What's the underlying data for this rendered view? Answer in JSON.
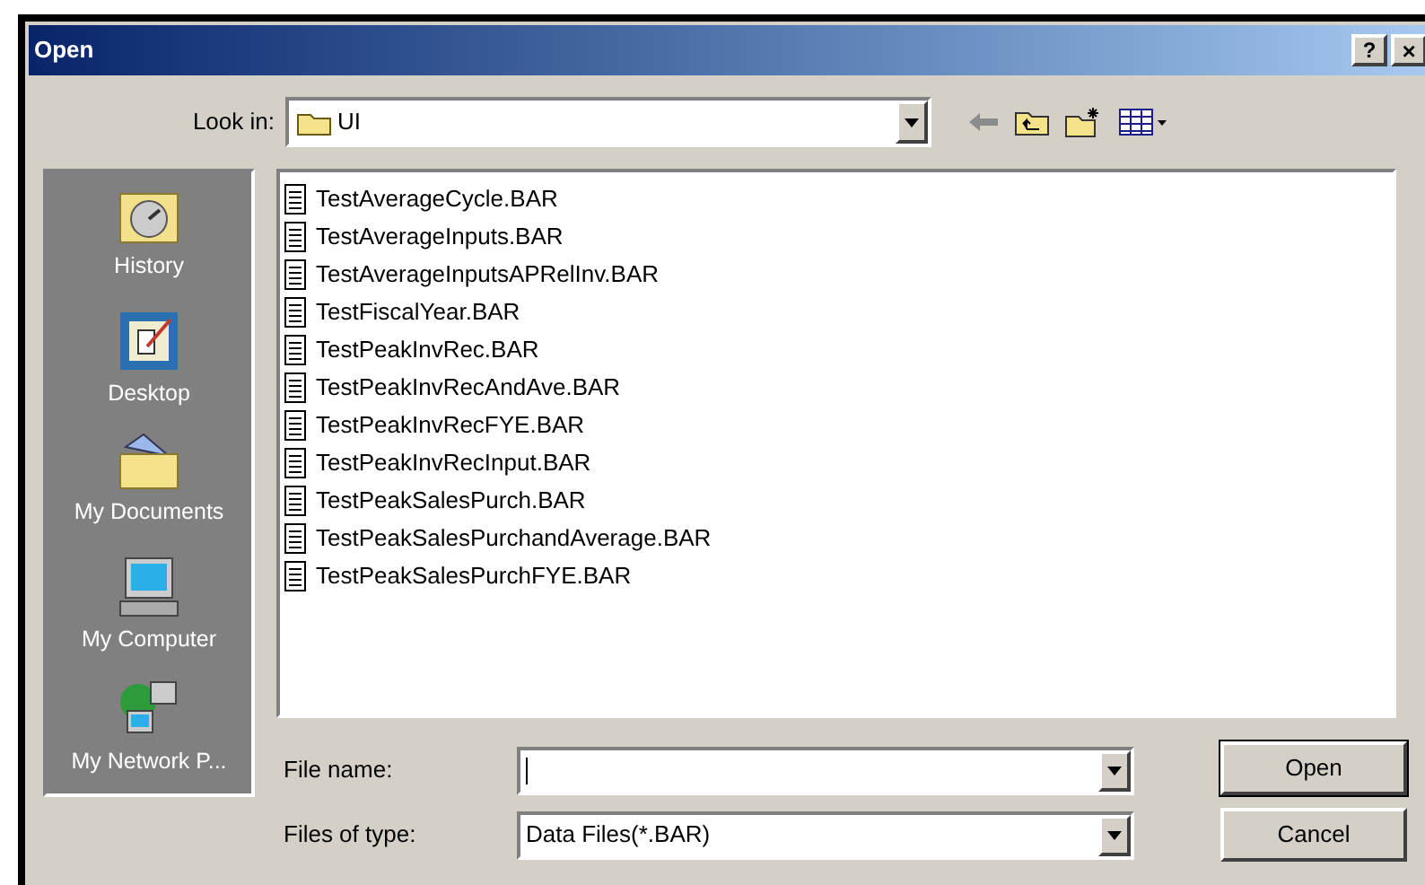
{
  "window": {
    "title": "Open",
    "help_button": "?",
    "close_button": "×"
  },
  "look_in": {
    "label": "Look in:",
    "value": "UI"
  },
  "places": [
    {
      "label": "History",
      "kind": "history"
    },
    {
      "label": "Desktop",
      "kind": "desktop"
    },
    {
      "label": "My Documents",
      "kind": "documents"
    },
    {
      "label": "My Computer",
      "kind": "computer"
    },
    {
      "label": "My Network P...",
      "kind": "network"
    }
  ],
  "files": [
    "TestAverageCycle.BAR",
    "TestAverageInputs.BAR",
    "TestAverageInputsAPRelInv.BAR",
    "TestFiscalYear.BAR",
    "TestPeakInvRec.BAR",
    "TestPeakInvRecAndAve.BAR",
    "TestPeakInvRecFYE.BAR",
    "TestPeakInvRecInput.BAR",
    "TestPeakSalesPurch.BAR",
    "TestPeakSalesPurchandAverage.BAR",
    "TestPeakSalesPurchFYE.BAR"
  ],
  "file_name": {
    "label": "File name:"
  },
  "file_type": {
    "label": "Files of type:",
    "value": "Data Files(*.BAR)"
  },
  "buttons": [
    "Open",
    "Cancel"
  ]
}
